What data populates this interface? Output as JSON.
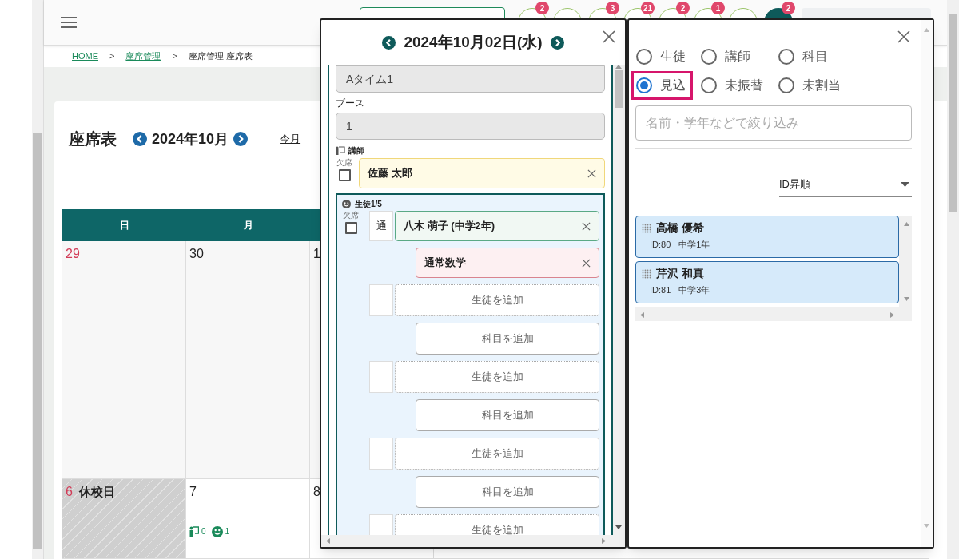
{
  "breadcrumbs": [
    {
      "kind": "link",
      "label": "HOME"
    },
    {
      "kind": "separator",
      "label": ">"
    },
    {
      "kind": "link",
      "label": "座席管理"
    },
    {
      "kind": "separator",
      "label": ">"
    },
    {
      "kind": "current",
      "label": "座席管理 座席表"
    }
  ],
  "toolbar": [
    {
      "kind": "plain",
      "badge": "2"
    },
    {
      "kind": "plain"
    },
    {
      "kind": "plain",
      "badge": "3"
    },
    {
      "kind": "plain",
      "badge": "21"
    },
    {
      "kind": "plain",
      "badge": "2"
    },
    {
      "kind": "plain",
      "badge": "1"
    },
    {
      "kind": "plain"
    },
    {
      "kind": "active",
      "badge": "2"
    }
  ],
  "calendar": {
    "title": "座席表",
    "month": "2024年10月",
    "today_link": "今月",
    "weekdays": [
      "日",
      "月"
    ],
    "weeks": [
      [
        {
          "day": "29",
          "sunday": true
        },
        {
          "day": "30",
          "sunday": false
        },
        {
          "day": "1",
          "sunday": false
        }
      ],
      [
        {
          "day": "6",
          "sunday": true,
          "closed": "休校日"
        },
        {
          "day": "7",
          "sunday": false,
          "teachers": "0",
          "students": "1"
        },
        {
          "day": "8",
          "sunday": false
        }
      ]
    ]
  },
  "day_panel": {
    "date": "2024年10月02日(水)",
    "time_slot": "Aタイム1",
    "booth_label": "ブース",
    "booth": "1",
    "teacher_label": "講師",
    "teacher": {
      "absent_label": "欠席",
      "absent": false,
      "name": "佐藤 太郎"
    },
    "students_label": "生徒1/5",
    "seats": [
      {
        "kind": "student",
        "absent_label": "欠席",
        "absent": false,
        "type": "通",
        "name": "八木 萌子 (中学2年)",
        "subject": "通常数学"
      },
      {
        "kind": "empty",
        "add_student": "生徒を追加",
        "add_subject": "科目を追加"
      },
      {
        "kind": "empty",
        "add_student": "生徒を追加",
        "add_subject": "科目を追加"
      },
      {
        "kind": "empty",
        "add_student": "生徒を追加",
        "add_subject": "科目を追加"
      },
      {
        "kind": "empty",
        "add_student": "生徒を追加"
      }
    ]
  },
  "filter_panel": {
    "modes": [
      {
        "label": "生徒",
        "selected": false,
        "highlighted": false
      },
      {
        "label": "講師",
        "selected": false,
        "highlighted": false
      },
      {
        "label": "科目",
        "selected": false,
        "highlighted": false
      },
      {
        "label": "見込",
        "selected": true,
        "highlighted": true
      },
      {
        "label": "未振替",
        "selected": false,
        "highlighted": false
      },
      {
        "label": "未割当",
        "selected": false,
        "highlighted": false
      }
    ],
    "search_placeholder": "名前・学年などで絞り込み",
    "sort": "ID昇順",
    "results": [
      {
        "name": "高橋 優希",
        "id": "ID:80",
        "grade": "中学1年"
      },
      {
        "name": "芹沢 和真",
        "id": "ID:81",
        "grade": "中学3年"
      }
    ]
  }
}
